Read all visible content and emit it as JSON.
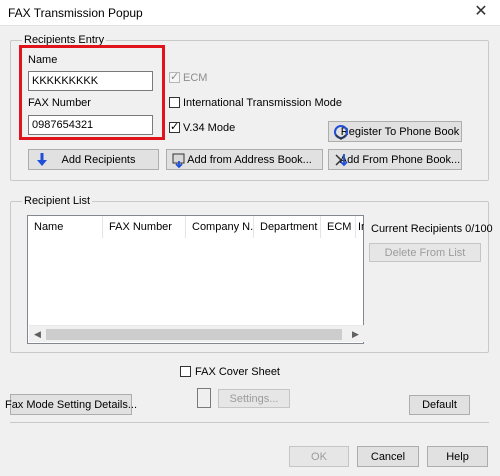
{
  "window": {
    "title": "FAX Transmission Popup",
    "close_glyph": "✕"
  },
  "recipients_entry": {
    "group_label": "Recipients Entry",
    "name_label": "Name",
    "name_value": "KKKKKKKKK",
    "fax_label": "FAX Number",
    "fax_value": "0987654321",
    "ecm_label": "ECM",
    "ecm_checked": true,
    "ecm_enabled": false,
    "intl_label": "International Transmission Mode",
    "intl_checked": false,
    "v34_label": "V.34 Mode",
    "v34_checked": true,
    "register_btn": "Register To Phone Book",
    "add_recipients_btn": "Add Recipients",
    "add_address_btn": "Add from Address Book...",
    "add_phone_btn": "Add From Phone Book..."
  },
  "recipient_list": {
    "group_label": "Recipient List",
    "columns": [
      "Name",
      "FAX Number",
      "Company N...",
      "Department",
      "ECM",
      "In"
    ],
    "rows": [],
    "current_label": "Current Recipients 0/100",
    "delete_btn": "Delete From List"
  },
  "cover_sheet": {
    "label": "FAX Cover Sheet",
    "checked": false,
    "settings_btn": "Settings..."
  },
  "footer": {
    "fax_mode_btn": "Fax Mode Setting Details...",
    "default_btn": "Default",
    "ok_btn": "OK",
    "cancel_btn": "Cancel",
    "help_btn": "Help"
  },
  "icons": {
    "add_recipients": "arrow-down-icon",
    "address_book": "address-book-icon",
    "phone_book": "phone-book-icon",
    "register": "register-phone-icon"
  },
  "colors": {
    "highlight": "#e0141a",
    "accent": "#1f4fd8"
  }
}
